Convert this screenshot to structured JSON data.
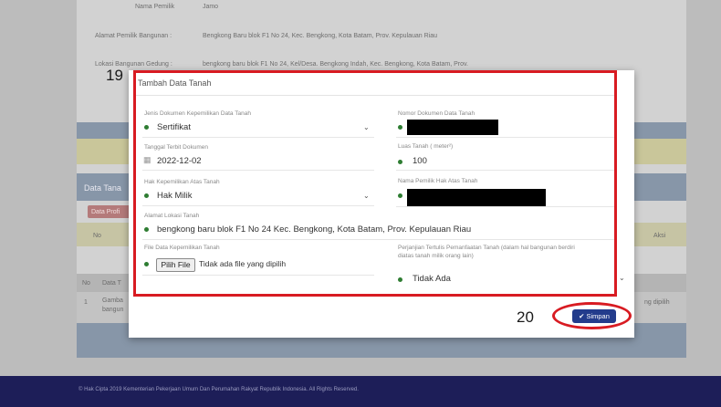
{
  "background": {
    "owner_name_label": "Nama Pemilik",
    "owner_name_value": "Jamo",
    "owner_address_label": "Alamat Pemilik Bangunan :",
    "owner_address_value": "Bengkong Baru blok F1 No 24, Kec. Bengkong, Kota Batam, Prov. Kepulauan Riau",
    "location_label": "Lokasi Bangunan Gedung :",
    "location_value": "bengkong baru blok F1 No 24, Kel/Desa. Bengkong Indah, Kec. Bengkong, Kota Batam, Prov.",
    "section_label": "Data Tana",
    "pill_label": "Data Profi",
    "col_no": "No",
    "col_aksi": "Aksi",
    "table_no": "No",
    "table_col": "Data T",
    "row_number": "1",
    "row_text_1": "Gamba",
    "row_text_2": "bangun",
    "right_text": "ng dipilih",
    "footer": "© Hak Cipta 2019 Kementerian Pekerjaan Umum Dan Perumahan Rakyat Republik Indonesia. All Rights Reserved."
  },
  "annotations": {
    "step_19": "19",
    "step_20": "20",
    "highlight_color": "#d81b22"
  },
  "modal": {
    "title": "Tambah Data Tanah",
    "fields": {
      "doc_type_label": "Jenis Dokumen Kepemilikan Data Tanah",
      "doc_type_value": "Sertifikat",
      "doc_number_label": "Nomor Dokumen Data Tanah",
      "issue_date_label": "Tanggal Terbit Dokumen",
      "issue_date_value": "2022-12-02",
      "area_label": "Luas Tanah ( meter²)",
      "area_value": "100",
      "ownership_right_label": "Hak Kepemilikan Atas Tanah",
      "ownership_right_value": "Hak Milik",
      "owner_name_label": "Nama Pemilik Hak Atas Tanah",
      "location_address_label": "Alamat Lokasi Tanah",
      "location_address_value": "bengkong baru blok F1 No 24 Kec. Bengkong, Kota Batam, Prov. Kepulauan Riau",
      "file_label": "File Data Kepemilikan Tanah",
      "file_button": "Pilih File",
      "file_status": "Tidak ada file yang dipilih",
      "agreement_label_1": "Perjanjian Tertulis Pemanfaatan Tanah (dalam hal bangunan berdiri",
      "agreement_label_2": "diatas tanah milik orang lain)",
      "agreement_value": "Tidak Ada"
    },
    "save_button": "✔ Simpan",
    "accent_color": "#233c8c",
    "status_dot_color": "#2e7d32"
  }
}
